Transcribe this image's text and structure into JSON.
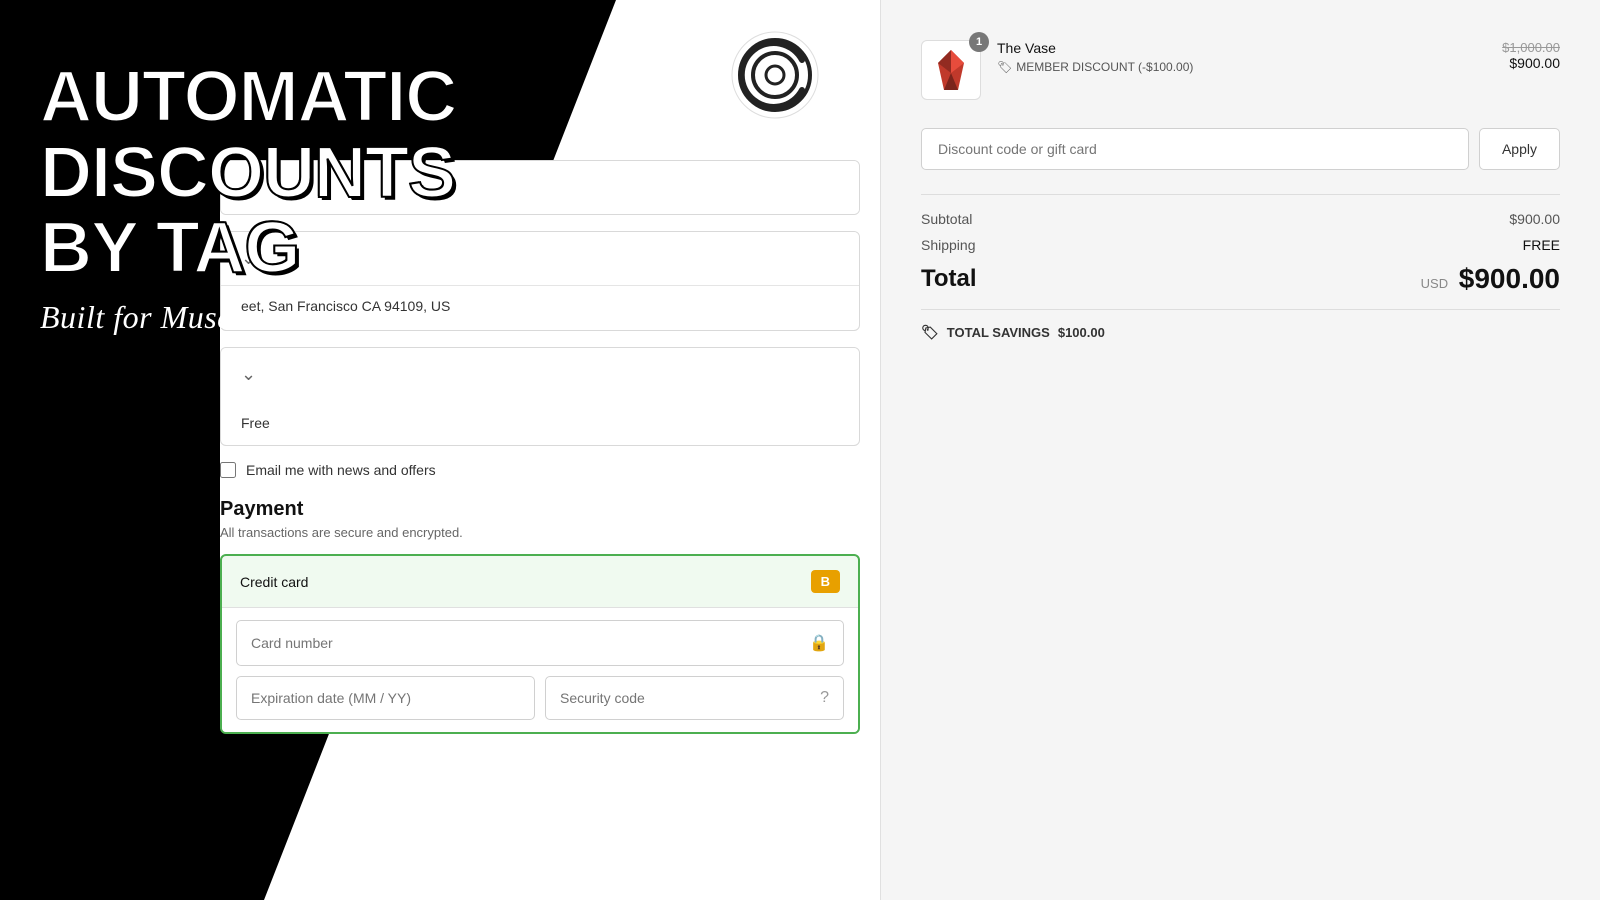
{
  "promo": {
    "line1": "AUTOMATIC",
    "line2": "DISCOUNTS",
    "line3": "BY TAG",
    "subtitle": "Built for Museums"
  },
  "logo": {
    "alt": "Logo"
  },
  "checkout": {
    "sections": [
      {
        "id": "contact",
        "collapsed": true
      },
      {
        "id": "shipping",
        "collapsed": true,
        "address": "eet, San Francisco CA 94109, US"
      },
      {
        "id": "delivery",
        "collapsed": true,
        "value": "Free"
      }
    ],
    "email_label": "Email me with news and offers",
    "payment_title": "Payment",
    "payment_subtitle": "All transactions are secure and encrypted.",
    "credit_card_label": "Credit card",
    "braintree_label": "B",
    "card_number_placeholder": "Card number",
    "expiry_placeholder": "Expiration date (MM / YY)",
    "security_placeholder": "Security code"
  },
  "order": {
    "product": {
      "name": "The Vase",
      "quantity": 1,
      "original_price": "$1,000.00",
      "sale_price": "$900.00",
      "discount_label": "MEMBER DISCOUNT (-$100.00)"
    },
    "discount_placeholder": "Discount code or gift card",
    "apply_label": "Apply",
    "subtotal_label": "Subtotal",
    "subtotal_value": "$900.00",
    "shipping_label": "Shipping",
    "shipping_value": "FREE",
    "total_label": "Total",
    "total_currency": "USD",
    "total_value": "$900.00",
    "savings_label": "TOTAL SAVINGS",
    "savings_value": "$100.00"
  }
}
